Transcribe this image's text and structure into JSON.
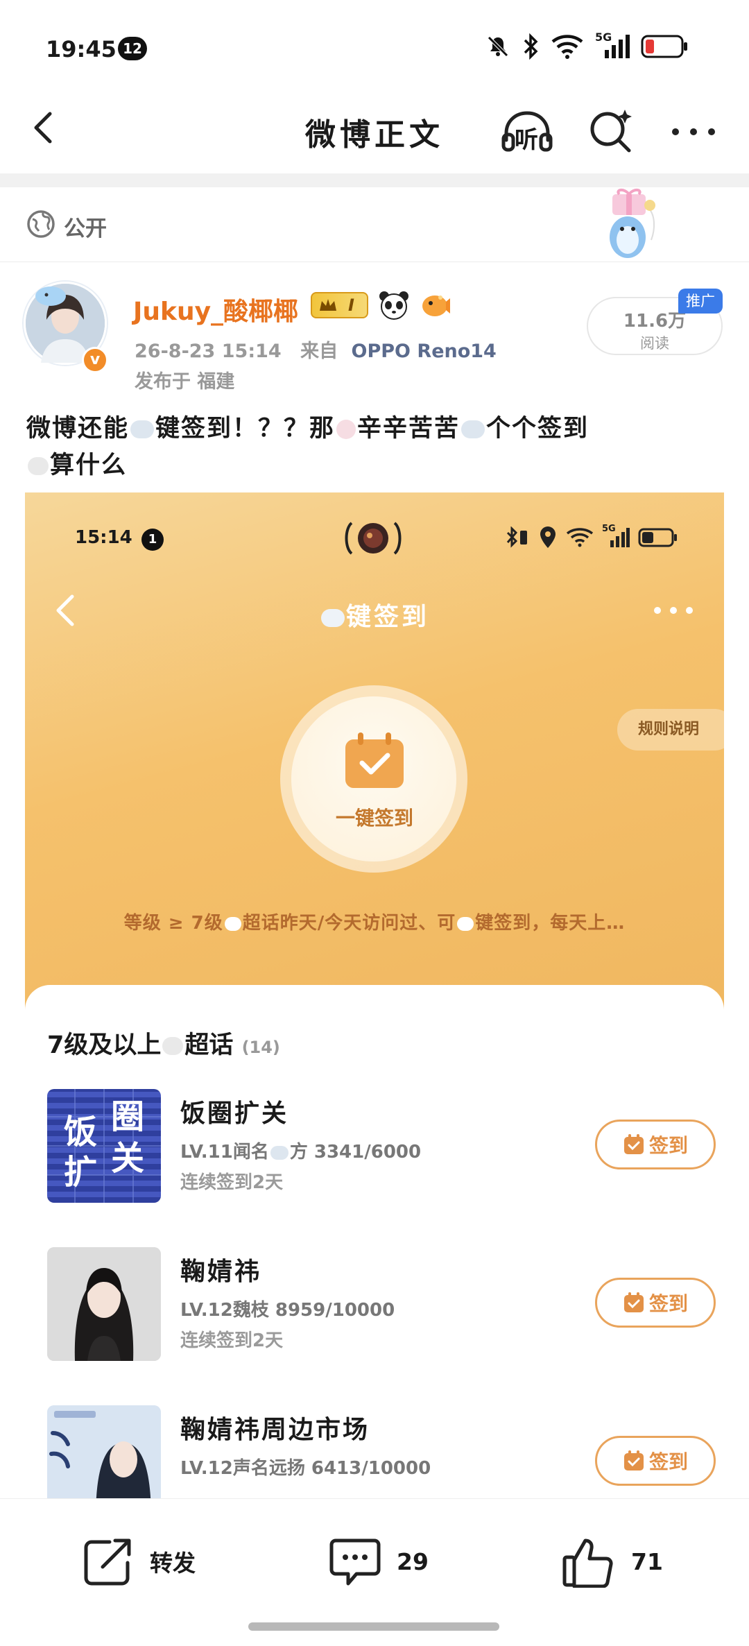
{
  "status_bar": {
    "time": "19:45",
    "notification_count": "12",
    "signal_label": "5G",
    "icons": [
      "mute-icon",
      "bluetooth-icon",
      "wifi-icon",
      "cell-signal-icon",
      "battery-low-icon"
    ],
    "battery_color": "#e53935"
  },
  "header": {
    "title": "微博正文",
    "listen_label": "听"
  },
  "post": {
    "visibility": "公开",
    "author": {
      "name": "Jukuy_酸椰椰",
      "level_badge": "I",
      "timestamp": "26-8-23  15:14",
      "source_prefix": "来自",
      "device": "OPPO Reno14",
      "location": "发布于  福建",
      "verified_mark": "v"
    },
    "views": "11.6万",
    "views_label": "阅读",
    "promo_label": "推广",
    "text": {
      "seg1": "微博还能",
      "seg2": "键签到！？？那",
      "seg3": "辛辛苦苦",
      "seg4": "个个签到",
      "seg5": "算什么"
    }
  },
  "embed": {
    "status": {
      "time": "15:14",
      "notification_count": "1",
      "signal_label": "5G"
    },
    "title": "键签到",
    "rules_label": "规则说明",
    "sign_label": "一键签到",
    "description_pre": "等级 ≥ 7级",
    "description_mid": "超话昨天/今天访问过、可",
    "description_post": "键签到，每天上…",
    "list_title": "7级及以上",
    "list_title_suffix": "超话",
    "list_count": "(14)",
    "topics": [
      {
        "name": "饭圈扩关",
        "level": "LV.11闻名",
        "level_suffix": "方  3341/6000",
        "streak": "连续签到2天",
        "button": "签到",
        "cover_text": [
          "饭",
          "圈",
          "扩",
          "关"
        ]
      },
      {
        "name": "鞠婧祎",
        "level": "LV.12魏枝  8959/10000",
        "streak": "连续签到2天",
        "button": "签到"
      },
      {
        "name": "鞠婧祎周边市场",
        "level": "LV.12声名远扬  6413/10000",
        "button": "签到"
      }
    ]
  },
  "bottom_bar": {
    "repost_label": "转发",
    "comment_count": "29",
    "like_count": "71"
  },
  "colors": {
    "accent_orange": "#e8731f",
    "embed_gradient_start": "#f6d79a",
    "embed_gradient_end": "#f0b760",
    "sign_button": "#e39147",
    "device_blue": "#5b6b8d",
    "promo_blue": "#3b7be8"
  }
}
